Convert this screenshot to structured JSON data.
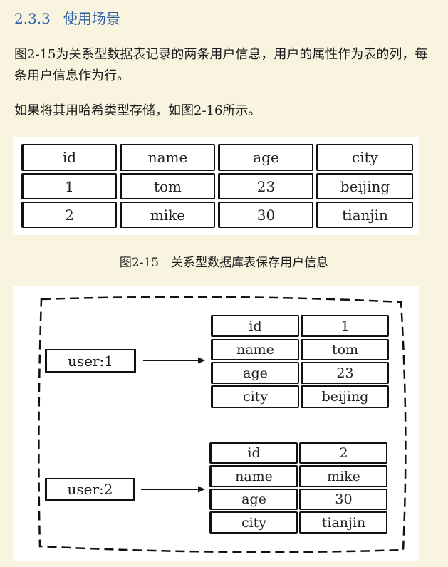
{
  "section": {
    "number": "2.3.3",
    "title": "使用场景"
  },
  "paragraphs": [
    "图2-15为关系型数据表记录的两条用户信息，用户的属性作为表的列，每条用户信息作为行。",
    "如果将其用哈希类型存储，如图2-16所示。"
  ],
  "table": {
    "headers": [
      "id",
      "name",
      "age",
      "city"
    ],
    "rows": [
      [
        "1",
        "tom",
        "23",
        "beijing"
      ],
      [
        "2",
        "mike",
        "30",
        "tianjin"
      ]
    ]
  },
  "caption": "图2-15　关系型数据库表保存用户信息",
  "hashes": [
    {
      "key": "user:1",
      "fields": [
        {
          "field": "id",
          "value": "1"
        },
        {
          "field": "name",
          "value": "tom"
        },
        {
          "field": "age",
          "value": "23"
        },
        {
          "field": "city",
          "value": "beijing"
        }
      ]
    },
    {
      "key": "user:2",
      "fields": [
        {
          "field": "id",
          "value": "2"
        },
        {
          "field": "name",
          "value": "mike"
        },
        {
          "field": "age",
          "value": "30"
        },
        {
          "field": "city",
          "value": "tianjin"
        }
      ]
    }
  ]
}
